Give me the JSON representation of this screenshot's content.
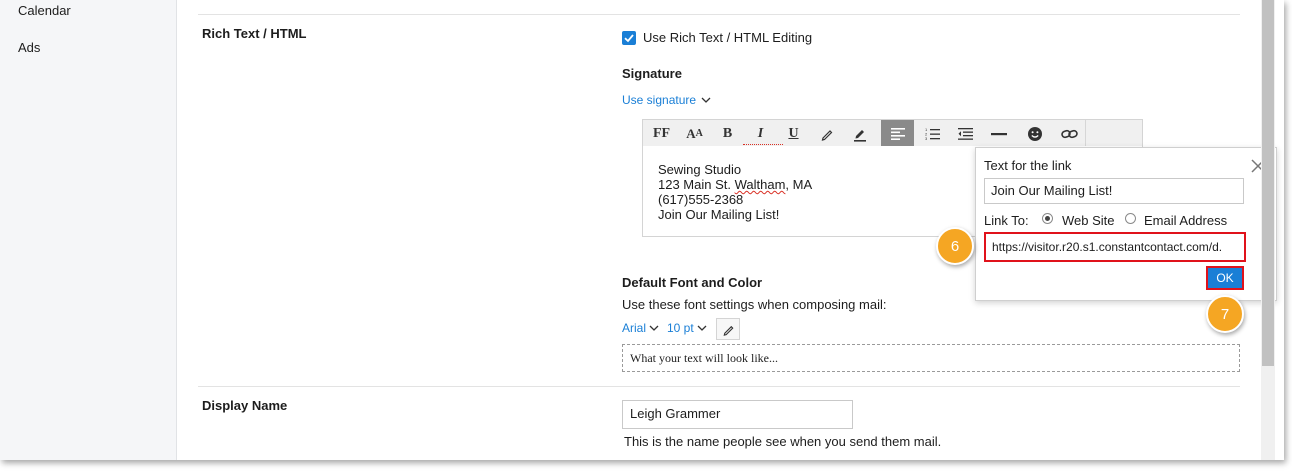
{
  "sidebar": {
    "items": [
      {
        "label": "Calendar"
      },
      {
        "label": "Ads"
      }
    ]
  },
  "rich_text": {
    "section_title": "Rich Text / HTML",
    "checkbox_label": "Use Rich Text / HTML Editing",
    "checkbox_checked": true,
    "signature_heading": "Signature",
    "use_signature_link": "Use signature",
    "toolbar": [
      {
        "name": "font-family-button",
        "glyph": "FF"
      },
      {
        "name": "font-size-button",
        "glyph": "Aᴀ"
      },
      {
        "name": "bold-button",
        "glyph": "B"
      },
      {
        "name": "italic-button",
        "glyph": "I"
      },
      {
        "name": "underline-button",
        "glyph": "U"
      },
      {
        "name": "text-color-pen-icon",
        "glyph": "✎"
      },
      {
        "name": "highlight-pen-icon",
        "glyph": "✎"
      },
      {
        "name": "align-left-button",
        "glyph": "≡"
      },
      {
        "name": "numbered-list-button",
        "glyph": "☰"
      },
      {
        "name": "outdent-button",
        "glyph": "☰"
      },
      {
        "name": "horizontal-rule-button",
        "glyph": "—"
      },
      {
        "name": "emoji-icon",
        "glyph": "☻"
      },
      {
        "name": "link-icon",
        "glyph": "⊘"
      }
    ],
    "signature_lines": [
      "Sewing Studio",
      "123 Main St. Waltham, MA",
      "(617)555-2368",
      "Join Our Mailing List!"
    ],
    "default_font_heading": "Default Font and Color",
    "font_settings_text": "Use these font settings when composing mail:",
    "font_name": "Arial",
    "font_size": "10 pt",
    "preview_text": "What your text will look like..."
  },
  "link_dialog": {
    "text_label": "Text for the link",
    "text_value": "Join Our Mailing List!",
    "link_to_label": "Link To:",
    "option_web": "Web Site",
    "option_email": "Email Address",
    "selected_option": "Web Site",
    "url_value": "https://visitor.r20.s1.constantcontact.com/d.",
    "ok_label": "OK"
  },
  "callouts": {
    "step6": "6",
    "step7": "7"
  },
  "display_name": {
    "section_title": "Display Name",
    "value": "Leigh Grammer",
    "help_text": "This is the name people see when you send them mail."
  },
  "colors": {
    "accent": "#1a7fd6",
    "highlight_red": "#e0121b",
    "callout_orange": "#f5a623"
  }
}
